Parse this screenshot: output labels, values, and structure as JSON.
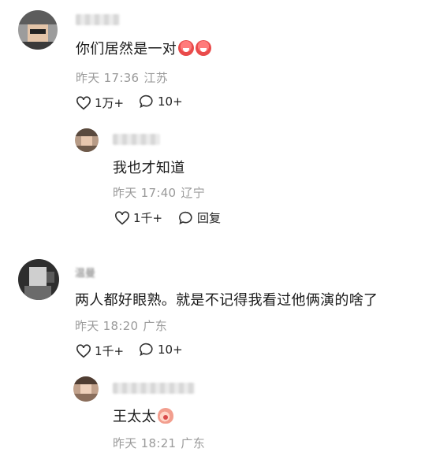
{
  "comments": [
    {
      "text": "你们居然是一对",
      "time": "昨天 17:36",
      "location": "江苏",
      "likes": "1万+",
      "replies": "10+",
      "emoji": [
        "laughing-face-icon",
        "laughing-face-icon"
      ]
    },
    {
      "text": "我也才知道",
      "time": "昨天 17:40",
      "location": "辽宁",
      "likes": "1千+",
      "reply_label": "回复"
    },
    {
      "author": "温曼",
      "text": "两人都好眼熟。就是不记得我看过他俩演的啥了",
      "time": "昨天 18:20",
      "location": "广东",
      "likes": "1千+",
      "replies": "10+"
    },
    {
      "text": "王太太",
      "time": "昨天 18:21",
      "location": "广东",
      "emoji": [
        "peach-face-icon"
      ]
    }
  ]
}
